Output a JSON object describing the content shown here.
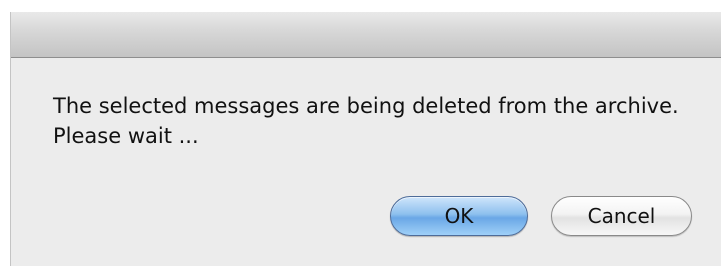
{
  "dialog": {
    "message": "The selected messages are being deleted from the archive. Please wait ...",
    "buttons": {
      "ok_label": "OK",
      "cancel_label": "Cancel"
    }
  },
  "colors": {
    "dialog_background": "#ececec",
    "default_button": "#8ec0ee",
    "text": "#111111"
  }
}
